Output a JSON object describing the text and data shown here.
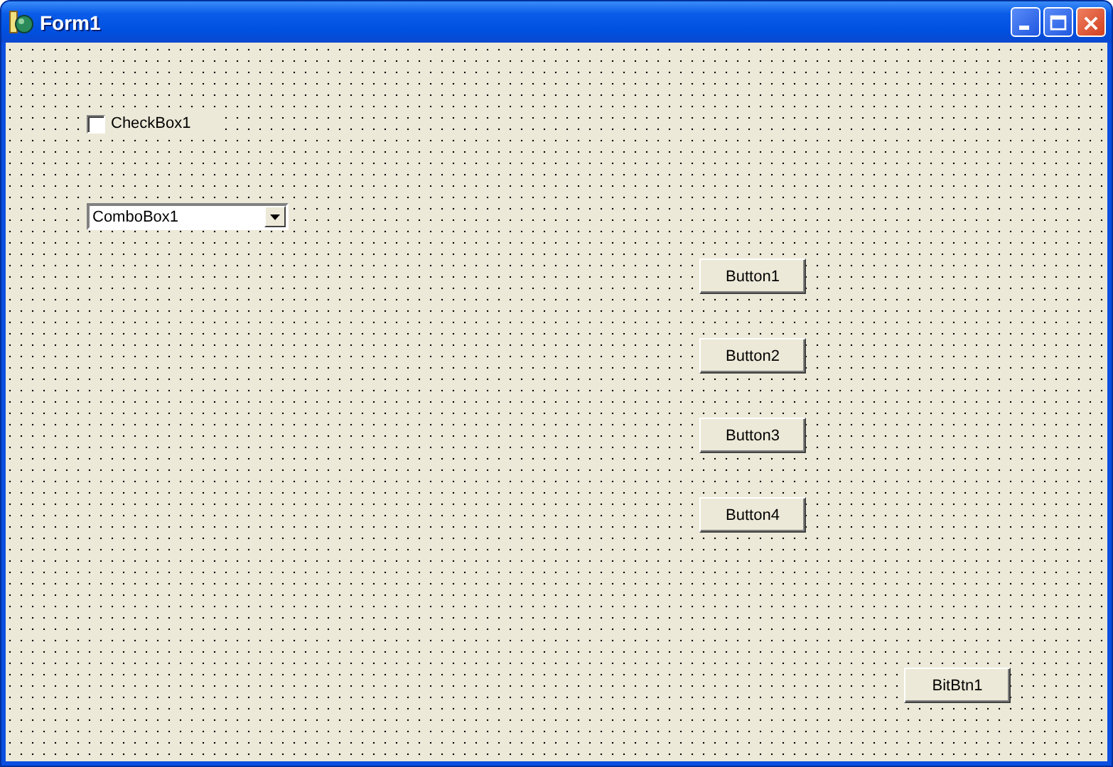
{
  "window": {
    "title": "Form1"
  },
  "controls": [
    {
      "kind": "checkbox",
      "label": "CheckBox1",
      "checked": false
    },
    {
      "kind": "combobox",
      "value": "ComboBox1"
    },
    {
      "kind": "button",
      "label": "Button1"
    },
    {
      "kind": "button",
      "label": "Button2"
    },
    {
      "kind": "button",
      "label": "Button3"
    },
    {
      "kind": "button",
      "label": "Button4"
    },
    {
      "kind": "button",
      "label": "BitBtn1"
    }
  ]
}
